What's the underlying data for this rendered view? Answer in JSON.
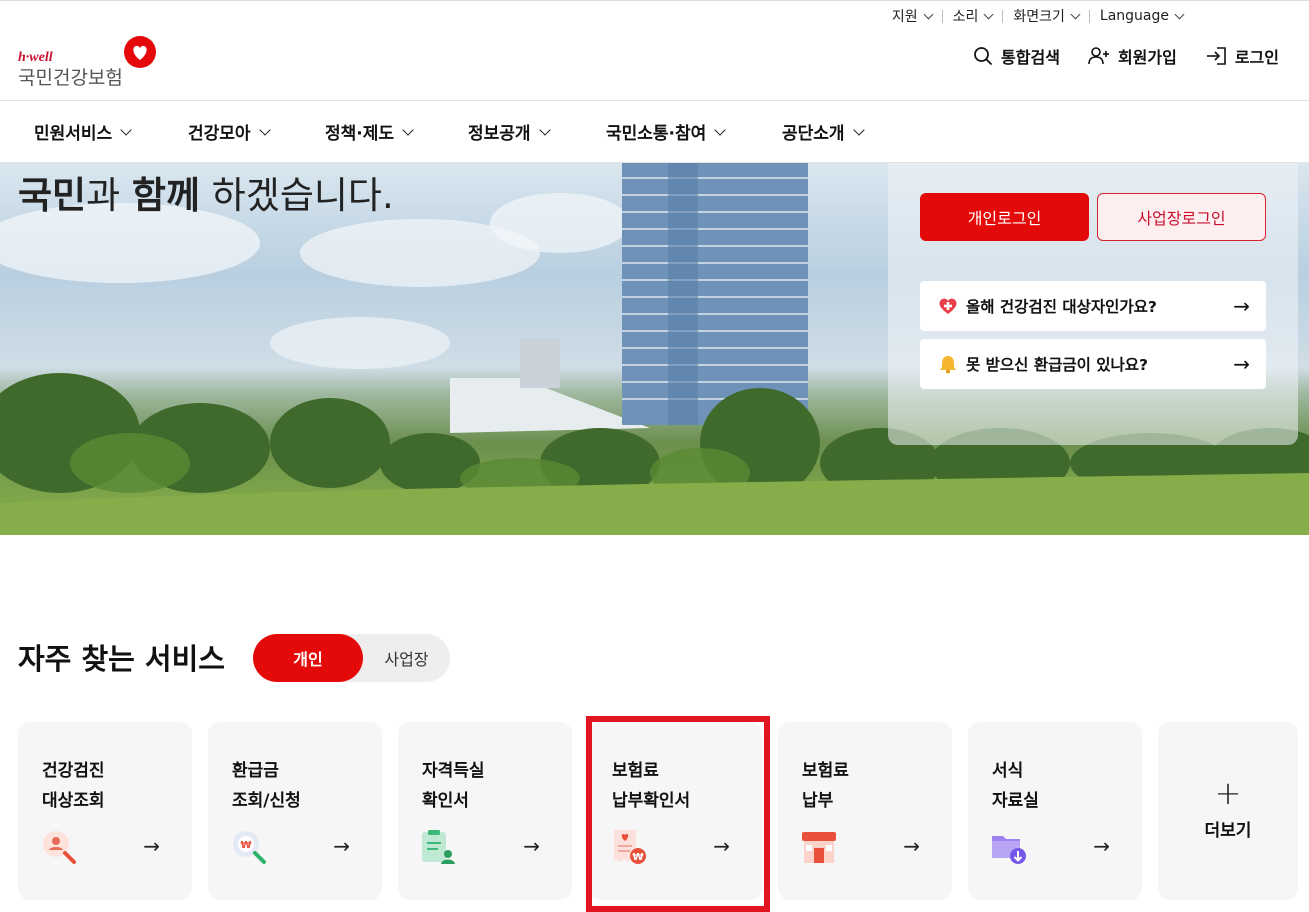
{
  "utility_nav": [
    "지원",
    "소리",
    "화면크기",
    "Language"
  ],
  "logo": {
    "brand": "h·well",
    "name": "국민건강보험"
  },
  "header_actions": {
    "search": "통합검색",
    "signup": "회원가입",
    "login": "로그인"
  },
  "gnb": [
    "민원서비스",
    "건강모아",
    "정책·제도",
    "정보공개",
    "국민소통·참여",
    "공단소개"
  ],
  "hero": {
    "slogan": {
      "w1": "국민",
      "w2": "과 ",
      "w3": "함께",
      "w4": " 하겠습니다."
    },
    "login_personal": "개인로그인",
    "login_business": "사업장로그인",
    "quick1": "올해 건강검진 대상자인가요?",
    "quick2": "못 받으신 환급금이 있나요?",
    "arrow": "→"
  },
  "services": {
    "title": "자주 찾는 서비스",
    "toggle_on": "개인",
    "toggle_off": "사업장",
    "cards": [
      {
        "line1": "건강검진",
        "line2": "대상조회",
        "icon": "search-person-icon"
      },
      {
        "line1": "환급금",
        "line2": "조회/신청",
        "icon": "won-search-icon"
      },
      {
        "line1": "자격득실",
        "line2": "확인서",
        "icon": "clipboard-person-icon"
      },
      {
        "line1": "보험료",
        "line2": "납부확인서",
        "icon": "receipt-won-icon"
      },
      {
        "line1": "보험료",
        "line2": "납부",
        "icon": "store-icon"
      },
      {
        "line1": "서식",
        "line2": "자료실",
        "icon": "folder-download-icon"
      }
    ],
    "more_plus": "+",
    "more_label": "더보기",
    "arrow": "→"
  },
  "colors": {
    "brand_red": "#e40a0a",
    "highlight": "#e0151f"
  }
}
